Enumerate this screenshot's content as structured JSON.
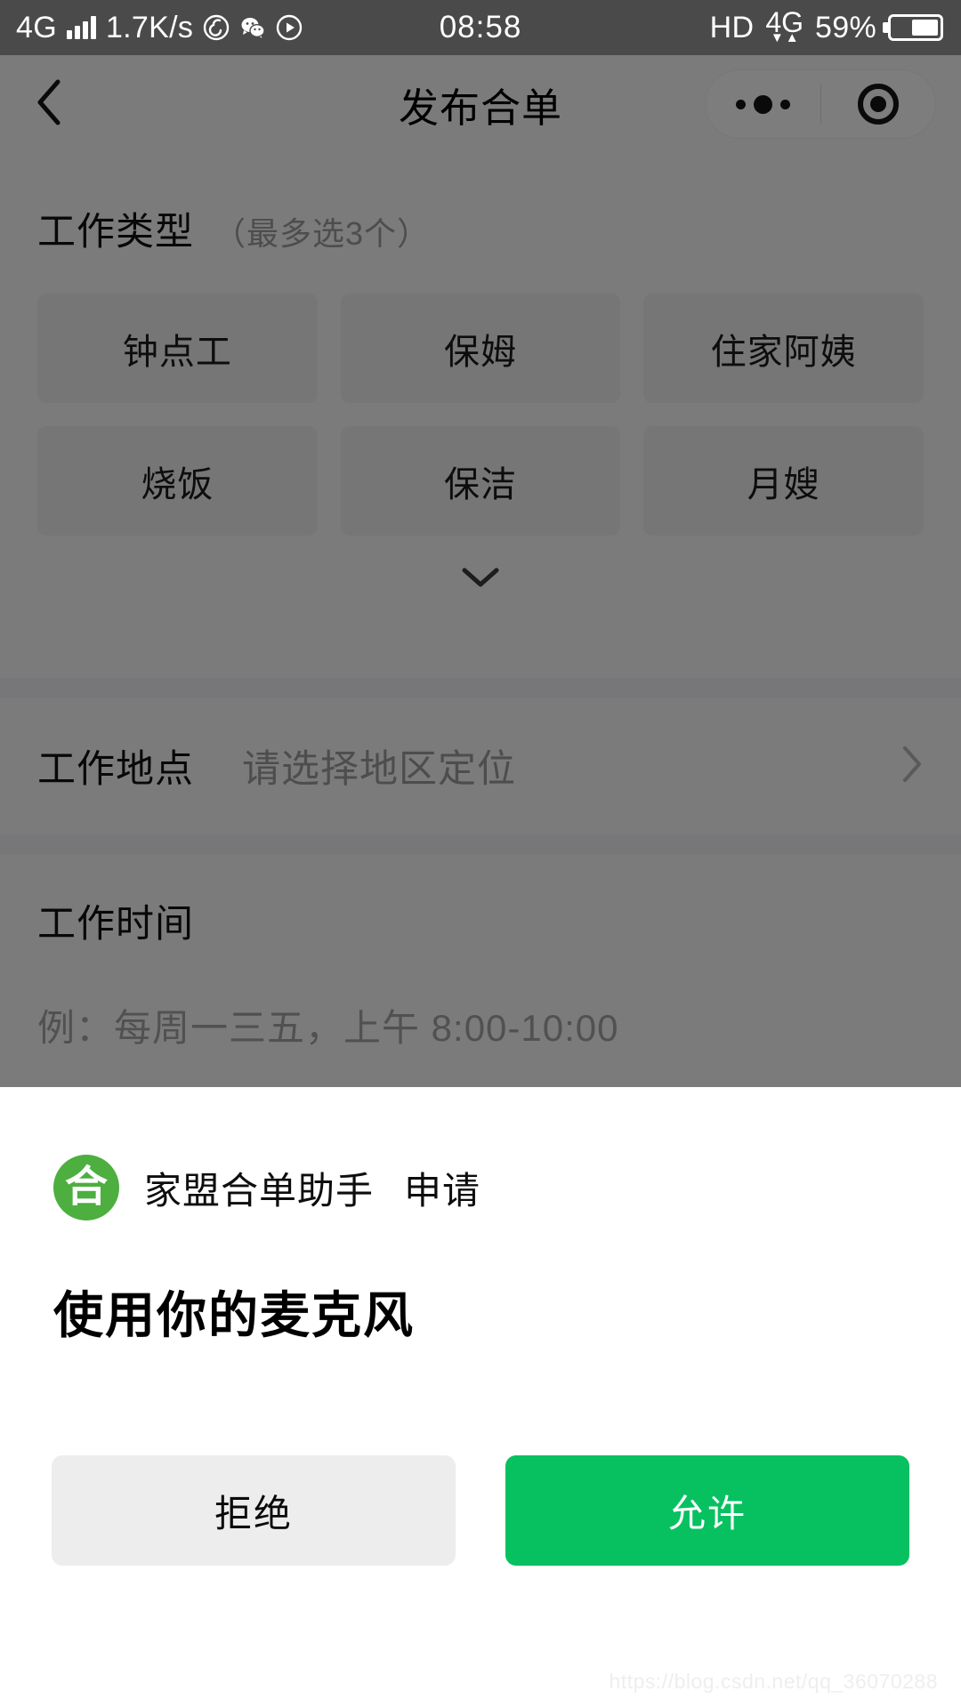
{
  "status_bar": {
    "network_label": "4G",
    "speed": "1.7K/s",
    "icons": [
      "netease-music-icon",
      "wechat-icon",
      "video-play-icon"
    ],
    "time": "08:58",
    "hd_label": "HD",
    "data_label": "4G",
    "battery_percent": "59%",
    "battery_level": 59
  },
  "nav": {
    "back_icon": "chevron-left-icon",
    "title": "发布合单",
    "capsule": {
      "more_icon": "more-dots-icon",
      "target_icon": "target-circle-icon"
    }
  },
  "form": {
    "work_type": {
      "title": "工作类型",
      "hint": "（最多选3个）",
      "chips": [
        {
          "label": "钟点工"
        },
        {
          "label": "保姆"
        },
        {
          "label": "住家阿姨"
        },
        {
          "label": "烧饭"
        },
        {
          "label": "保洁"
        },
        {
          "label": "月嫂"
        }
      ],
      "expand_icon": "chevron-down-icon"
    },
    "work_location": {
      "label": "工作地点",
      "placeholder": "请选择地区定位",
      "value": "",
      "chevron_icon": "chevron-right-icon"
    },
    "work_time": {
      "label": "工作时间",
      "placeholder": "例：每周一三五，上午 8:00-10:00",
      "value": ""
    }
  },
  "permission_dialog": {
    "app_icon_glyph": "合",
    "app_icon_color": "#4caf3f",
    "app_name": "家盟合单助手",
    "action_label": "申请",
    "headline": "使用你的麦克风",
    "deny_label": "拒绝",
    "allow_label": "允许",
    "allow_color": "#07c160",
    "deny_color": "#ededed"
  },
  "watermark": "https://blog.csdn.net/qq_36070288"
}
